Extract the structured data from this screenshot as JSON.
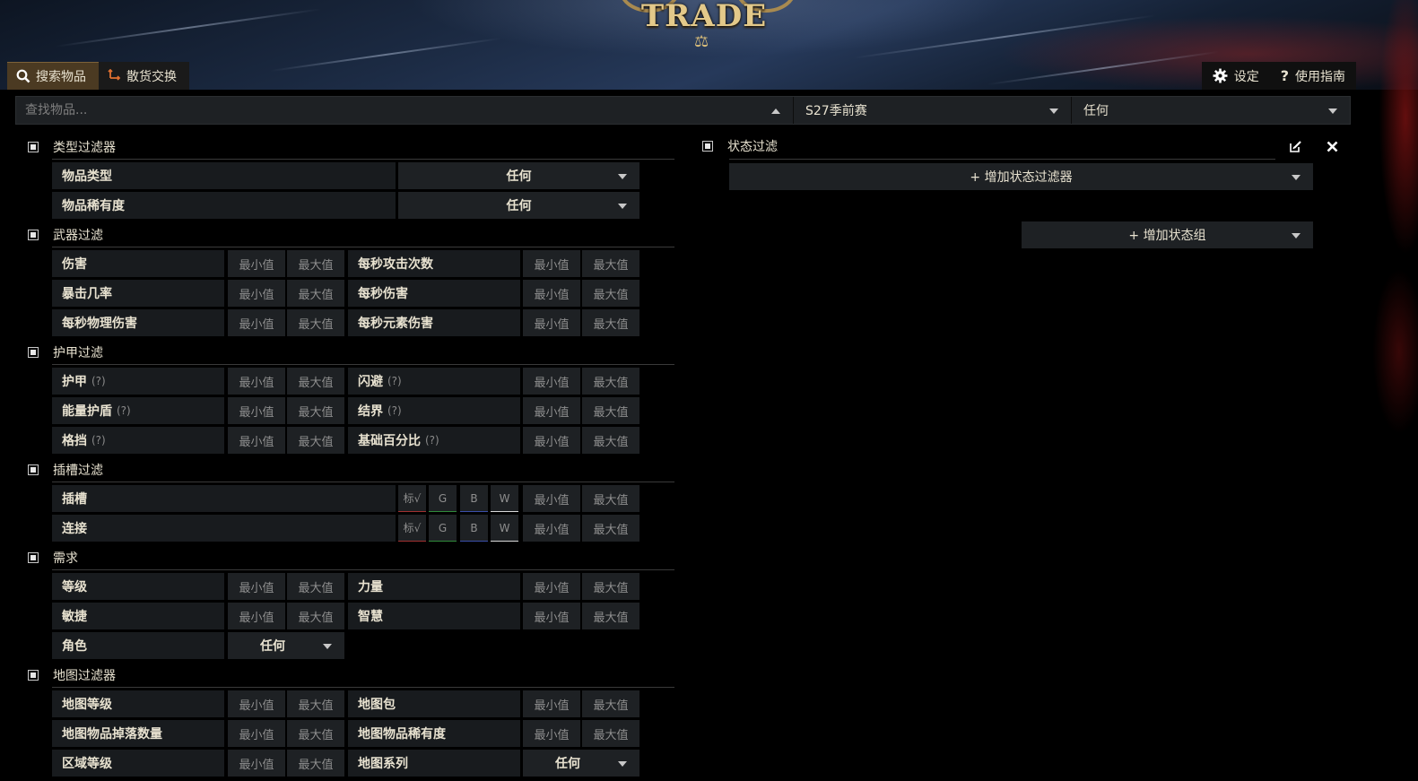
{
  "brand": {
    "logo_text": "TRADE"
  },
  "tabs": {
    "search": "搜索物品",
    "exchange": "散货交换"
  },
  "top_right": {
    "settings": "设定",
    "guide": "使用指南"
  },
  "search": {
    "placeholder": "查找物品...",
    "league": "S27季前赛",
    "status": "任何"
  },
  "placeholders": {
    "min": "最小值",
    "max": "最大值",
    "any": "任何",
    "white": "标√",
    "G": "G",
    "B": "B",
    "W": "W"
  },
  "groups": {
    "type": {
      "title": "类型过滤器",
      "item_type": "物品类型",
      "rarity": "物品稀有度",
      "item_type_value": "任何",
      "rarity_value": "任何"
    },
    "weapon": {
      "title": "武器过滤",
      "damage": "伤害",
      "aps": "每秒攻击次数",
      "crit": "暴击几率",
      "dps": "每秒伤害",
      "pdps": "每秒物理伤害",
      "edps": "每秒元素伤害"
    },
    "armour": {
      "title": "护甲过滤",
      "armour": "护甲",
      "evasion": "闪避",
      "es": "能量护盾",
      "ward": "结界",
      "block": "格挡",
      "base_pct": "基础百分比",
      "hint": "(?)"
    },
    "socket": {
      "title": "插槽过滤",
      "sockets": "插槽",
      "links": "连接"
    },
    "req": {
      "title": "需求",
      "level": "等级",
      "str": "力量",
      "dex": "敏捷",
      "int": "智慧",
      "class": "角色",
      "class_value": "任何"
    },
    "map": {
      "title": "地图过滤器",
      "tier": "地图等级",
      "packsize": "地图包",
      "iiq": "地图物品掉落数量",
      "iir": "地图物品稀有度",
      "area_level": "区域等级",
      "series": "地图系列",
      "series_value": "任何"
    }
  },
  "stat": {
    "title": "状态过滤",
    "add_filter": "+ 增加状态过滤器",
    "add_group": "+ 增加状态组"
  },
  "icons": {
    "search": "search-icon",
    "exchange": "exchange-icon",
    "settings": "gear-icon",
    "guide": "question-icon",
    "edit": "edit-icon",
    "close": "close-icon"
  },
  "colors": {
    "tab_active": "#4b3a22",
    "panel": "#1e2124",
    "label_bg": "#181b1e",
    "text": "#e8e2d0"
  }
}
